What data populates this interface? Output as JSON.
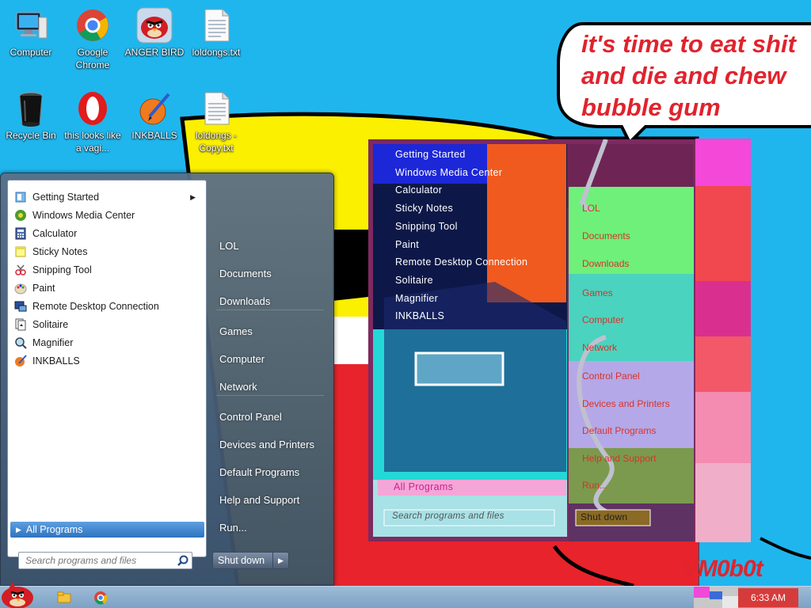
{
  "desktop": {
    "icons": [
      {
        "label": "Computer",
        "icon": "computer-icon"
      },
      {
        "label": "Google Chrome",
        "icon": "chrome-icon"
      },
      {
        "label": "ANGER BIRD",
        "icon": "angry-bird-icon"
      },
      {
        "label": "loldongs.txt",
        "icon": "text-file-icon"
      },
      {
        "label": "Recycle Bin",
        "icon": "recycle-bin-icon"
      },
      {
        "label": "this looks like a vagi...",
        "icon": "opera-icon"
      },
      {
        "label": "INKBALLS",
        "icon": "inkballs-icon"
      },
      {
        "label": "loldongs - Copy.txt",
        "icon": "text-file-icon"
      }
    ]
  },
  "wallpaper": {
    "bubble_text": "it's time to eat shit\nand die and chew\nbubble gum",
    "watermark": "VM0b0t"
  },
  "start_menu": {
    "programs": [
      {
        "label": "Getting Started",
        "icon": "getting-started-icon",
        "has_submenu": true
      },
      {
        "label": "Windows Media Center",
        "icon": "media-center-icon"
      },
      {
        "label": "Calculator",
        "icon": "calculator-icon"
      },
      {
        "label": "Sticky Notes",
        "icon": "sticky-notes-icon"
      },
      {
        "label": "Snipping Tool",
        "icon": "snipping-tool-icon"
      },
      {
        "label": "Paint",
        "icon": "paint-icon"
      },
      {
        "label": "Remote Desktop Connection",
        "icon": "remote-desktop-icon"
      },
      {
        "label": "Solitaire",
        "icon": "solitaire-icon"
      },
      {
        "label": "Magnifier",
        "icon": "magnifier-icon"
      },
      {
        "label": "INKBALLS",
        "icon": "inkballs-icon"
      }
    ],
    "all_programs": "All Programs",
    "search_placeholder": "Search programs and files",
    "right_items": [
      "LOL",
      "Documents",
      "Downloads",
      "Games",
      "Computer",
      "Network",
      "Control Panel",
      "Devices and Printers",
      "Default Programs",
      "Help and Support",
      "Run..."
    ],
    "shutdown_label": "Shut down"
  },
  "ghost_menu": {
    "programs": [
      "Getting Started",
      "Windows Media Center",
      "Calculator",
      "Sticky Notes",
      "Snipping Tool",
      "Paint",
      "Remote Desktop Connection",
      "Solitaire",
      "Magnifier",
      "INKBALLS"
    ],
    "all_programs": "All Programs",
    "search_placeholder": "Search programs and files",
    "right_items": [
      "LOL",
      "Documents",
      "Downloads",
      "Games",
      "Computer",
      "Network",
      "Control Panel",
      "Devices and Printers",
      "Default Programs",
      "Help and Support",
      "Run..."
    ],
    "shutdown_label": "Shut down"
  },
  "taskbar": {
    "clock": "6:33 AM",
    "pinned": [
      "explorer-icon",
      "chrome-icon"
    ]
  },
  "colors": {
    "desktop_bg": "#1fb6ee",
    "bubble_text": "#e0232d",
    "start_menu_glass": "#5a6e87",
    "all_programs_highlight": "#2e73c0"
  }
}
